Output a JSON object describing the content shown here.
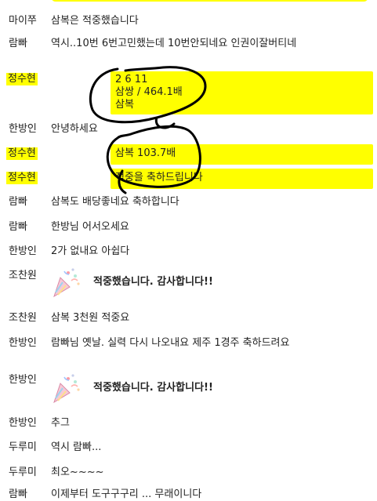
{
  "messages": [
    {
      "sender": "마이쭈",
      "text": "삼복은 적중했습니다"
    },
    {
      "sender": "람빠",
      "text": "역시..10번 6번고민했는데 10번안되네요 인권이잘버티네"
    },
    {
      "sender": "정수현",
      "lines": [
        "2 6 11",
        "삼쌍 / 464.1배",
        "삼복"
      ]
    },
    {
      "sender": "한방인",
      "text": "안녕하세요"
    },
    {
      "sender": "정수현",
      "text": "삼복 103.7배"
    },
    {
      "sender": "정수현",
      "text": "적중을 축하드립니다"
    },
    {
      "sender": "람빠",
      "text": "삼복도 배당좋네요 축하합니다"
    },
    {
      "sender": "람빠",
      "text": "한방님 어서오세요"
    },
    {
      "sender": "한방인",
      "text": "2가 없내요 아쉽다"
    },
    {
      "sender": "조찬원",
      "text": "적중했습니다. 감사합니다!!"
    },
    {
      "sender": "조찬원",
      "text": "삼복 3천원 적중요"
    },
    {
      "sender": "한방인",
      "text": "람빠님 옛날. 실력 다시 나오내요 제주 1경주 축하드려요"
    },
    {
      "sender": "한방인",
      "text": "적중했습니다. 감사합니다!!"
    },
    {
      "sender": "한방인",
      "text": "추그"
    },
    {
      "sender": "두루미",
      "text": "역시 람빠..."
    },
    {
      "sender": "두루미",
      "text": "최오~~~~"
    },
    {
      "sender": "람빠",
      "text": "이제부터 도구구구리 ... 무래이니다"
    }
  ],
  "colors": {
    "highlight": "#ffff00",
    "scribble": "#000000"
  },
  "icons": {
    "celebration": "party-popper-icon"
  }
}
